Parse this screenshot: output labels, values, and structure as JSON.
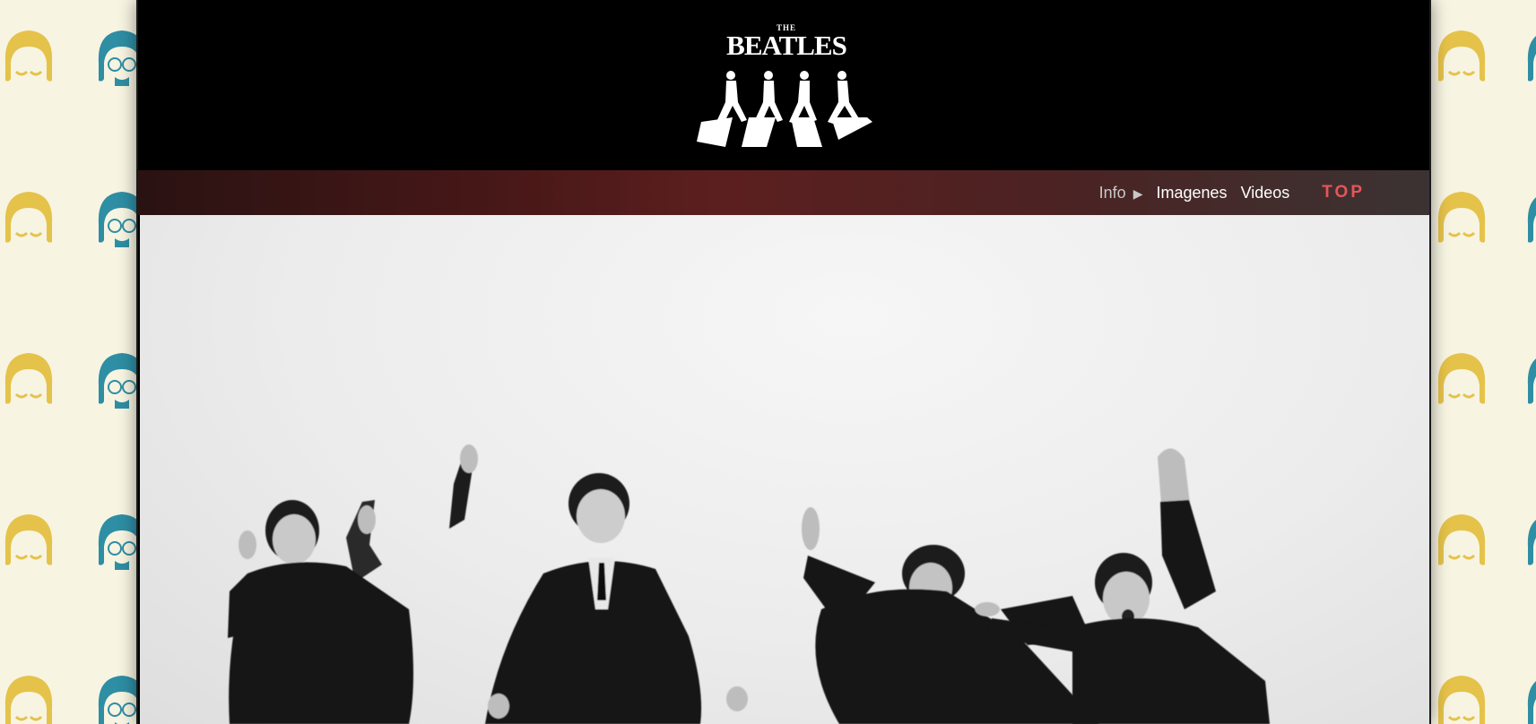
{
  "logo": {
    "small_text": "THE",
    "name": "BEATLES",
    "emblem": "abbey-road-crossing"
  },
  "nav": {
    "info_label": "Info",
    "info_arrow": "▶",
    "images_label": "Imagenes",
    "videos_label": "Videos",
    "top_label": "TOP"
  },
  "hero": {
    "photo_subject": "four-men-jumping-bw-photo"
  },
  "colors": {
    "page_background": "#f7f4e2",
    "pattern_yellow": "#e5c24a",
    "pattern_teal": "#2e8ea4",
    "header_background": "#000000",
    "nav_accent": "#5c1f1f",
    "top_link": "#e5555a"
  }
}
